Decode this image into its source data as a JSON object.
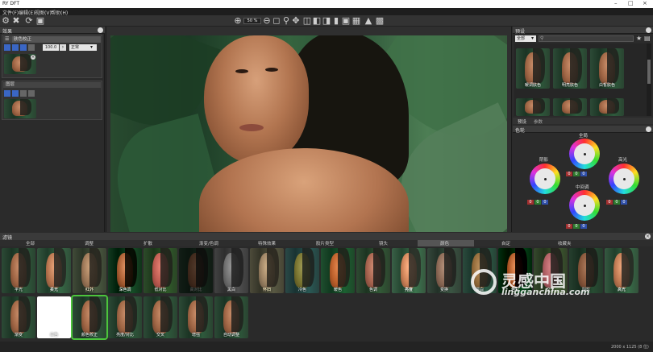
{
  "window": {
    "title": "RY DFT"
  },
  "menu": {
    "items": [
      "文件(F)",
      "编辑(E)",
      "视图(V)",
      "帮助(H)"
    ]
  },
  "toolbar_center": {
    "zoom_value": "50 %"
  },
  "left_panel": {
    "head_title": "效果",
    "layer1": {
      "name": "肤色校正",
      "opacity": "100.0",
      "blend_mode": "正常"
    },
    "layer2_head": "图层"
  },
  "right_panel": {
    "presets_head": "预设",
    "presets_filter": "全部",
    "preset_thumbs": [
      {
        "label": "暖调肤色"
      },
      {
        "label": "明亮肤色"
      },
      {
        "label": "白皙肤色"
      }
    ],
    "tabs": [
      "预设",
      "参数"
    ],
    "color_head": "色轮",
    "wheels": {
      "global": "全局",
      "shadow": "阴影",
      "highlight": "高光",
      "midtone": "中间调"
    },
    "zero": "0"
  },
  "bottom": {
    "head_title": "滤镜",
    "tabs": [
      "全部",
      "调整",
      "扩散",
      "渐变/色调",
      "特殊效果",
      "胶片类型",
      "镜头",
      "颜色",
      "自定",
      "收藏夹"
    ],
    "row1": [
      "平光",
      "柔光",
      "红外",
      "深色调",
      "低对比",
      "高对比",
      "黑白",
      "怀旧",
      "冷色",
      "暖色",
      "色调",
      "亮度",
      "变换",
      "漂白",
      "色彩",
      "交叉",
      "阴影",
      "高光"
    ],
    "row2": [
      "渐变",
      "白色",
      "颜色校正",
      "亮度/对比",
      "交叉",
      "增强",
      "自动调整"
    ]
  },
  "status": {
    "dims": "2000 x 1125 (8 位)"
  },
  "watermark": {
    "cn": "灵感中国",
    "en": "lingganchina.com"
  },
  "colors": {
    "accent": "#3c6fd6",
    "panel_bg": "#2b2b2b",
    "header_bg": "#3b3b3b"
  }
}
